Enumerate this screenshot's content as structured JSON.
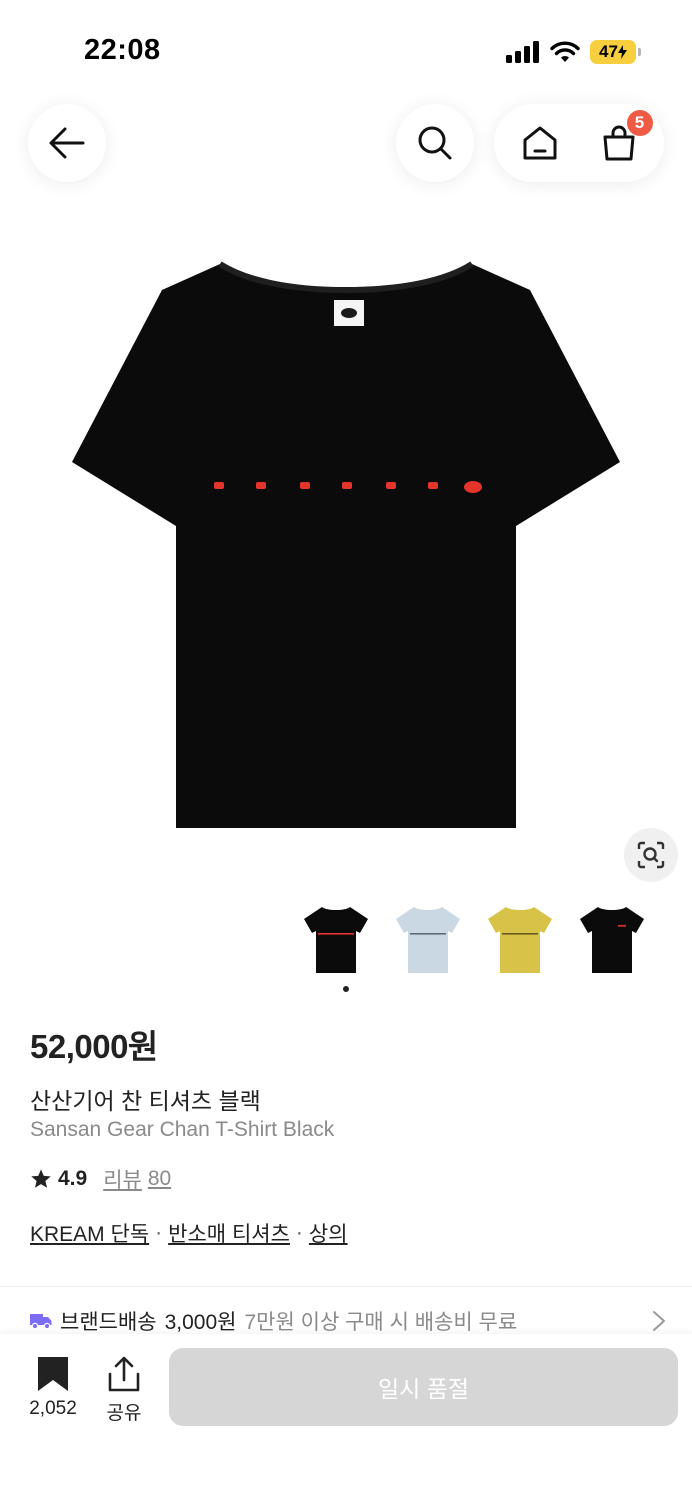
{
  "status_bar": {
    "time": "22:08",
    "battery": "47"
  },
  "nav": {
    "cart_badge": "5"
  },
  "product": {
    "price": "52,000원",
    "name_ko": "산산기어 찬 티셔츠 블랙",
    "name_en": "Sansan Gear Chan T-Shirt Black",
    "rating": "4.9",
    "review_label": "리뷰",
    "review_count": "80",
    "thumbnail_colors": [
      "#0b0b0b",
      "#c9d8e3",
      "#d9c248",
      "#0b0b0b"
    ],
    "main_color": "#0b0b0b",
    "print_color": "#e5342a"
  },
  "breadcrumbs": {
    "items": [
      "KREAM 단독",
      "반소매 티셔츠",
      "상의"
    ],
    "separator": "·"
  },
  "shipping": {
    "brand": "브랜드배송",
    "fee": "3,000원",
    "note": "7만원 이상 구매 시 배송비 무료",
    "icon_color": "#7b6cf6"
  },
  "bottom_bar": {
    "bookmark_count": "2,052",
    "share_label": "공유",
    "buy_label": "일시 품절"
  },
  "icons": [
    "back-arrow-icon",
    "search-icon",
    "home-icon",
    "cart-icon",
    "lens-search-icon",
    "truck-icon",
    "chevron-right-icon",
    "bookmark-icon",
    "share-icon",
    "star-icon"
  ]
}
